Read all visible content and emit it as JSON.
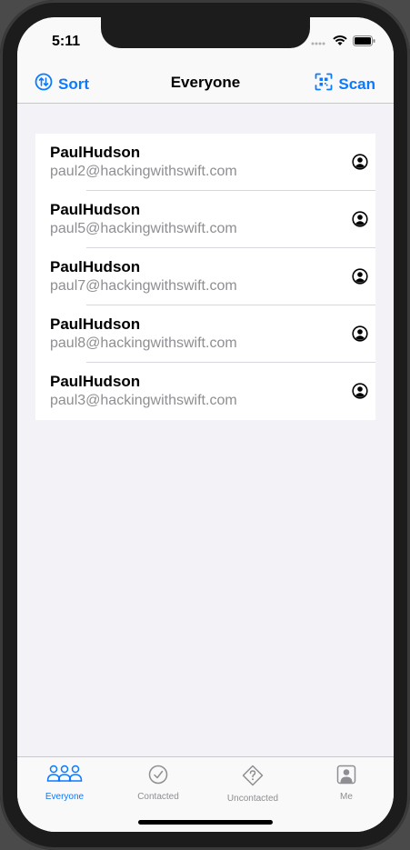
{
  "status": {
    "time": "5:11"
  },
  "nav": {
    "title": "Everyone",
    "sort_label": "Sort",
    "scan_label": "Scan",
    "sort_icon": "arrow-up-down-circle-icon",
    "scan_icon": "qrcode-viewfinder-icon"
  },
  "contacts": [
    {
      "name": "PaulHudson",
      "email": "paul2@hackingwithswift.com"
    },
    {
      "name": "PaulHudson",
      "email": "paul5@hackingwithswift.com"
    },
    {
      "name": "PaulHudson",
      "email": "paul7@hackingwithswift.com"
    },
    {
      "name": "PaulHudson",
      "email": "paul8@hackingwithswift.com"
    },
    {
      "name": "PaulHudson",
      "email": "paul3@hackingwithswift.com"
    }
  ],
  "tabs": [
    {
      "label": "Everyone",
      "icon": "people-icon",
      "active": true
    },
    {
      "label": "Contacted",
      "icon": "checkmark-circle-icon",
      "active": false
    },
    {
      "label": "Uncontacted",
      "icon": "questionmark-diamond-icon",
      "active": false
    },
    {
      "label": "Me",
      "icon": "person-square-icon",
      "active": false
    }
  ],
  "colors": {
    "accent": "#0a7aff",
    "inactive": "#8e8e93"
  }
}
